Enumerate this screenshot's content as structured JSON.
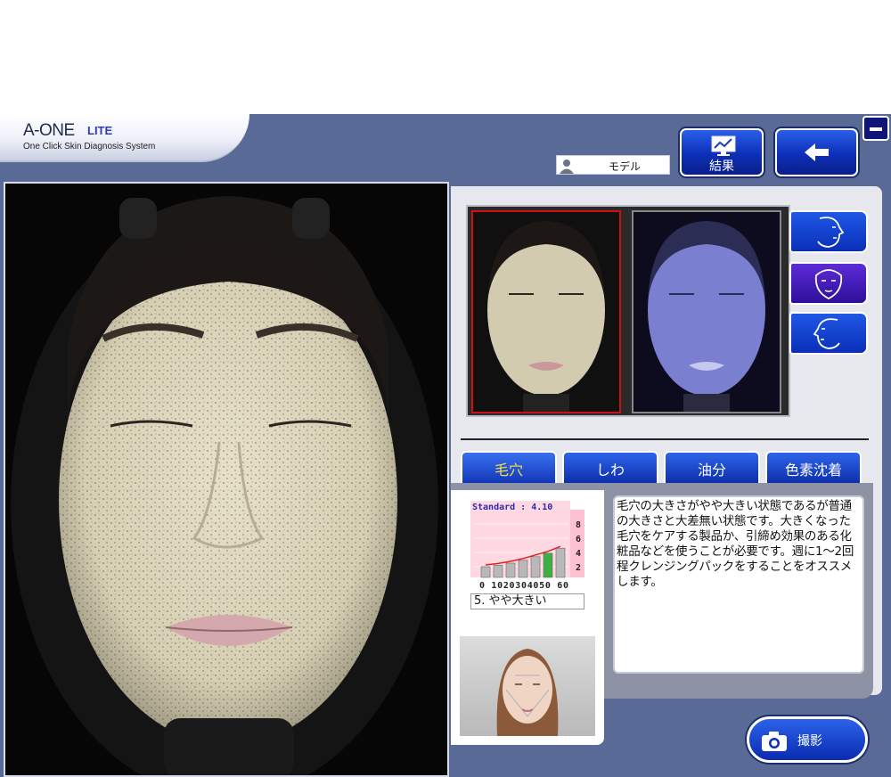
{
  "app": {
    "title": "A-ONE",
    "edition": "LITE",
    "subtitle": "One Click Skin Diagnosis System"
  },
  "header": {
    "user_name": "モデル",
    "result_label": "結果"
  },
  "tabs": [
    {
      "label": "毛穴",
      "active": true
    },
    {
      "label": "しわ",
      "active": false
    },
    {
      "label": "油分",
      "active": false
    },
    {
      "label": "色素沈着",
      "active": false
    }
  ],
  "graph": {
    "standard_label": "Standard : 4.10",
    "y_ticks": [
      "8",
      "6",
      "4",
      "2"
    ],
    "x_ticks": "0 1020304050 60",
    "values": [
      1.5,
      1.7,
      2.0,
      2.4,
      2.9,
      3.4,
      4.1
    ],
    "highlight_index": 5,
    "level_text": "5. やや大きい"
  },
  "description": "毛穴の大きさがやや大きい状態であるが普通の大きさと大差無い状態です。大きくなった毛穴をケアする製品か、引締め効果のある化粧品などを使うことが必要です。週に1～2回程クレンジングパックをすることをオススメします。",
  "shoot_label": "撮影",
  "colors": {
    "app_bg": "#5a6a96",
    "button_blue": "#0d2fb8",
    "active_tab_text": "#f3e04a",
    "selected_thumb_border": "#d01010"
  }
}
